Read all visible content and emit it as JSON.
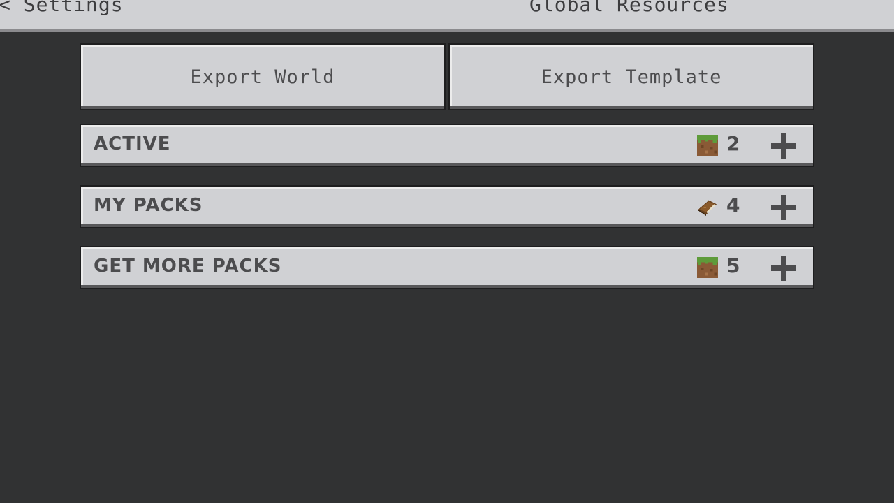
{
  "header": {
    "back_label": "< Settings",
    "tab_label": "Global Resources"
  },
  "actions": {
    "export_world": "Export World",
    "export_template": "Export Template"
  },
  "sections": [
    {
      "label": "ACTIVE",
      "count": "2",
      "icon": "grass-block-icon"
    },
    {
      "label": "MY PACKS",
      "count": "4",
      "icon": "book-icon"
    },
    {
      "label": "GET MORE PACKS",
      "count": "5",
      "icon": "grass-block-icon"
    }
  ],
  "colors": {
    "background": "#313233",
    "panel": "#d0d1d4",
    "text": "#4c4c4e"
  }
}
